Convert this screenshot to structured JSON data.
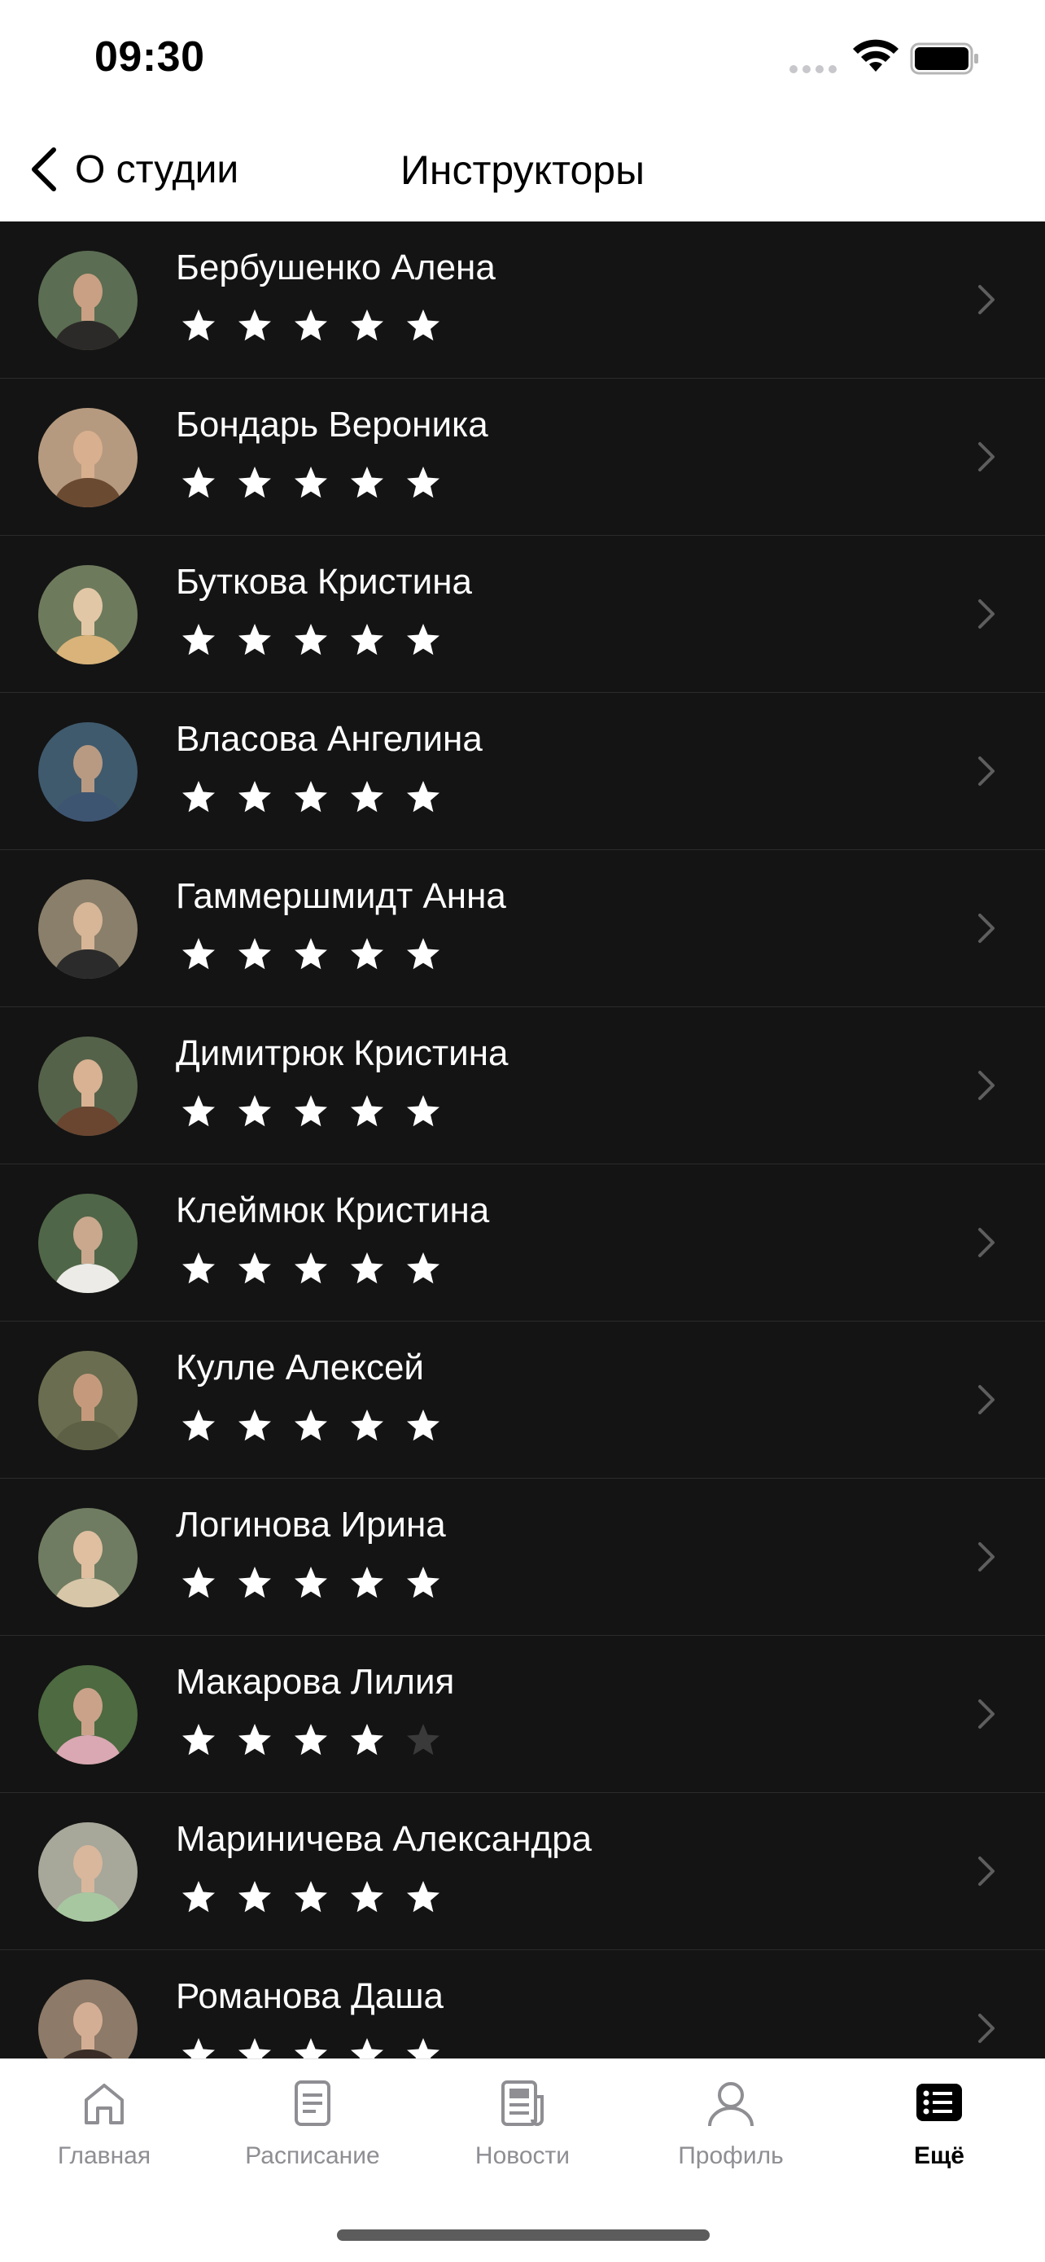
{
  "status_bar": {
    "time": "09:30"
  },
  "nav": {
    "back_label": "О студии",
    "title": "Инструкторы"
  },
  "instructors": [
    {
      "name": "Бербушенко Алена",
      "rating": 5,
      "avatar_colors": [
        "#5b6d52",
        "#c9a083",
        "#2c2a28"
      ]
    },
    {
      "name": "Бондарь Вероника",
      "rating": 5,
      "avatar_colors": [
        "#b69a7f",
        "#d8b08f",
        "#6b4a32"
      ]
    },
    {
      "name": "Буткова Кристина",
      "rating": 5,
      "avatar_colors": [
        "#6e7a5c",
        "#e2c7a6",
        "#d9b37a"
      ]
    },
    {
      "name": "Власова Ангелина",
      "rating": 5,
      "avatar_colors": [
        "#3f5a6d",
        "#b89a82",
        "#3e5572"
      ]
    },
    {
      "name": "Гаммершмидт Анна",
      "rating": 5,
      "avatar_colors": [
        "#8a7f6a",
        "#d7b597",
        "#2b2b2b"
      ]
    },
    {
      "name": "Димитрюк Кристина",
      "rating": 5,
      "avatar_colors": [
        "#55624a",
        "#d9b293",
        "#6a4530"
      ]
    },
    {
      "name": "Клеймюк Кристина",
      "rating": 5,
      "avatar_colors": [
        "#506648",
        "#c9a88e",
        "#ecebe7"
      ]
    },
    {
      "name": "Кулле Алексей",
      "rating": 5,
      "avatar_colors": [
        "#6a6d4f",
        "#c59a7c",
        "#5d6044"
      ]
    },
    {
      "name": "Логинова Ирина",
      "rating": 5,
      "avatar_colors": [
        "#6f7c61",
        "#e0bfa1",
        "#d7c6a8"
      ]
    },
    {
      "name": "Макарова Лилия",
      "rating": 4,
      "avatar_colors": [
        "#4d6a40",
        "#caa28a",
        "#d9a8b2"
      ]
    },
    {
      "name": "Мариничева Александра",
      "rating": 5,
      "avatar_colors": [
        "#a7a79a",
        "#d8b79c",
        "#a7c7a0"
      ]
    },
    {
      "name": "Романова Даша",
      "rating": 5,
      "avatar_colors": [
        "#8d7a68",
        "#d4ae94",
        "#3a2d27"
      ]
    }
  ],
  "tabs": [
    {
      "label": "Главная",
      "icon": "home-icon",
      "active": false
    },
    {
      "label": "Расписание",
      "icon": "schedule-icon",
      "active": false
    },
    {
      "label": "Новости",
      "icon": "news-icon",
      "active": false
    },
    {
      "label": "Профиль",
      "icon": "profile-icon",
      "active": false
    },
    {
      "label": "Ещё",
      "icon": "more-icon",
      "active": true
    }
  ],
  "colors": {
    "list_background": "#141414",
    "star_filled": "#ffffff",
    "star_empty": "#3a3a3a",
    "tab_inactive": "#8e8e93"
  }
}
